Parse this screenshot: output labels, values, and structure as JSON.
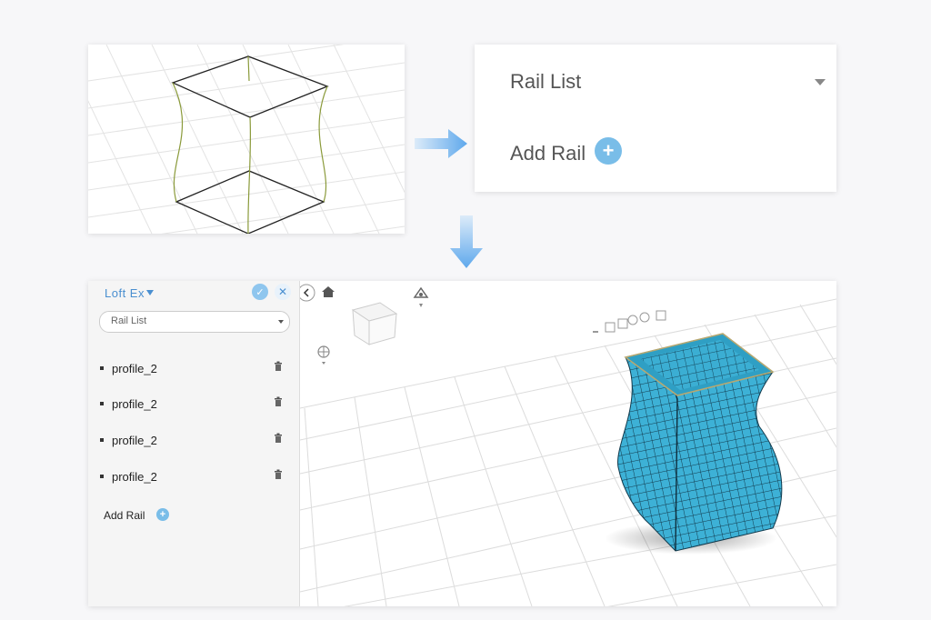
{
  "card": {
    "title": "Rail List",
    "add_label": "Add Rail"
  },
  "sidebar": {
    "header": "Loft Ex",
    "select_value": "Rail List",
    "rails": [
      {
        "label": "profile_2"
      },
      {
        "label": "profile_2"
      },
      {
        "label": "profile_2"
      },
      {
        "label": "profile_2"
      }
    ],
    "add_label": "Add Rail"
  },
  "colors": {
    "accent": "#79bde8",
    "mesh_fill": "#3db1d6",
    "mesh_line": "#123a4d",
    "arrow": "#6aaee8"
  },
  "icons": {
    "ok": "check-icon",
    "cancel": "close-icon",
    "home": "home-icon",
    "trash": "trash-icon",
    "add": "plus-circle-icon"
  }
}
